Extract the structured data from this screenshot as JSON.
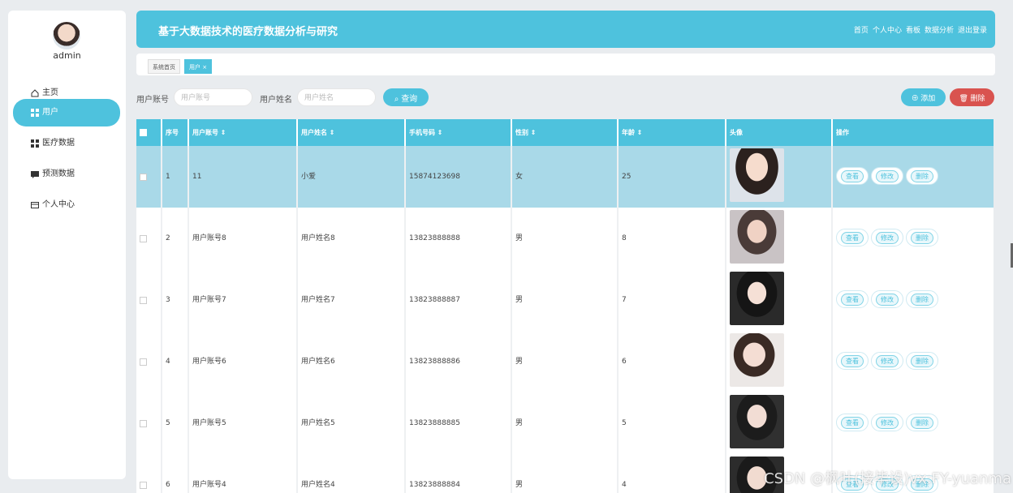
{
  "sidebar": {
    "username": "admin",
    "items": [
      {
        "label": "主页",
        "icon": "home-icon"
      },
      {
        "label": "用户",
        "icon": "grid-icon",
        "active": true
      },
      {
        "label": "医疗数据",
        "icon": "grid-icon"
      },
      {
        "label": "预测数据",
        "icon": "comment-icon"
      },
      {
        "label": "个人中心",
        "icon": "card-icon"
      }
    ]
  },
  "header": {
    "title": "基于大数据技术的医疗数据分析与研究",
    "nav": [
      "首页",
      "个人中心",
      "看板",
      "数据分析",
      "退出登录"
    ]
  },
  "tabs": [
    {
      "label": "系统首页"
    },
    {
      "label": "用户 ×"
    }
  ],
  "search": {
    "account_label": "用户账号",
    "account_placeholder": "用户账号",
    "name_label": "用户姓名",
    "name_placeholder": "用户姓名",
    "search_button": "查询",
    "add_button": "添加",
    "delete_button": "删除"
  },
  "table": {
    "columns": [
      "序号",
      "用户账号",
      "用户姓名",
      "手机号码",
      "性别",
      "年龄",
      "头像",
      "操作"
    ],
    "sortable": [
      "用户账号",
      "用户姓名",
      "手机号码",
      "性别",
      "年龄"
    ],
    "rows": [
      {
        "idx": "1",
        "account": "11",
        "name": "小爱",
        "phone": "15874123698",
        "gender": "女",
        "age": "25"
      },
      {
        "idx": "2",
        "account": "用户账号8",
        "name": "用户姓名8",
        "phone": "13823888888",
        "gender": "男",
        "age": "8"
      },
      {
        "idx": "3",
        "account": "用户账号7",
        "name": "用户姓名7",
        "phone": "13823888887",
        "gender": "男",
        "age": "7"
      },
      {
        "idx": "4",
        "account": "用户账号6",
        "name": "用户姓名6",
        "phone": "13823888886",
        "gender": "男",
        "age": "6"
      },
      {
        "idx": "5",
        "account": "用户账号5",
        "name": "用户姓名5",
        "phone": "13823888885",
        "gender": "男",
        "age": "5"
      },
      {
        "idx": "6",
        "account": "用户账号4",
        "name": "用户姓名4",
        "phone": "13823888884",
        "gender": "男",
        "age": "4"
      }
    ],
    "row_actions": [
      "查看",
      "修改",
      "删除"
    ]
  },
  "watermark": "CSDN @枫叶(接毕设)vx:FY-yuanma",
  "colors": {
    "accent": "#4ec2dd",
    "danger": "#d9534f",
    "highlight_row": "#a9d9e8"
  }
}
